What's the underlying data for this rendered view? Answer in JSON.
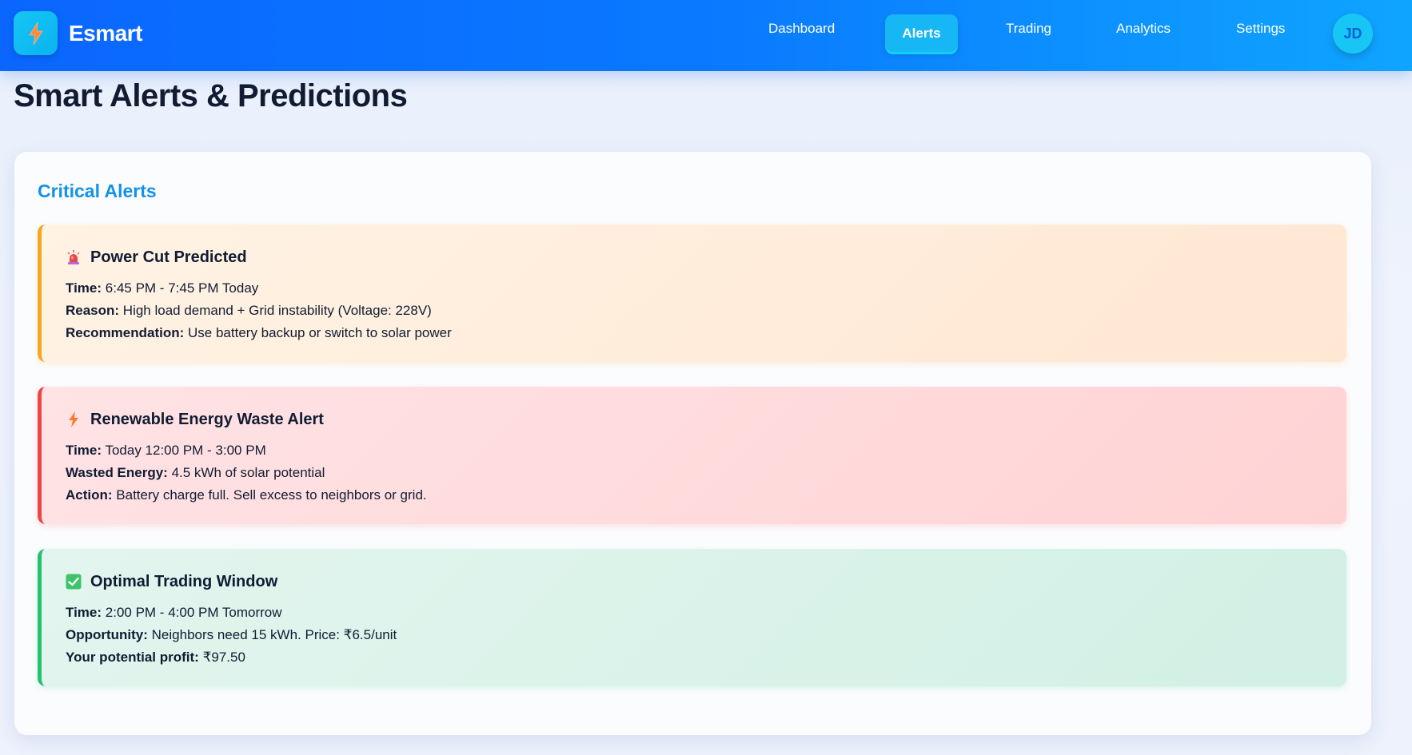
{
  "header": {
    "brand": "Esmart",
    "nav": {
      "dashboard": "Dashboard",
      "alerts": "Alerts",
      "trading": "Trading",
      "analytics": "Analytics",
      "settings": "Settings"
    },
    "avatar_initials": "JD",
    "active_tab": "Alerts"
  },
  "page": {
    "title": "Smart Alerts & Predictions"
  },
  "section": {
    "title": "Critical Alerts"
  },
  "alerts": [
    {
      "icon": "siren-icon",
      "title": "Power Cut Predicted",
      "color": "#f5a623",
      "lines": [
        {
          "label": "Time:",
          "value": " 6:45 PM - 7:45 PM Today"
        },
        {
          "label": "Reason:",
          "value": " High load demand + Grid instability (Voltage: 228V)"
        },
        {
          "label": "Recommendation:",
          "value": " Use battery backup or switch to solar power"
        }
      ]
    },
    {
      "icon": "lightning-icon",
      "title": "Renewable Energy Waste Alert",
      "color": "#f04545",
      "lines": [
        {
          "label": "Time:",
          "value": " Today 12:00 PM - 3:00 PM"
        },
        {
          "label": "Wasted Energy:",
          "value": " 4.5 kWh of solar potential"
        },
        {
          "label": "Action:",
          "value": " Battery charge full. Sell excess to neighbors or grid."
        }
      ]
    },
    {
      "icon": "check-box-icon",
      "title": "Optimal Trading Window",
      "color": "#22c36b",
      "lines": [
        {
          "label": "Time:",
          "value": " 2:00 PM - 4:00 PM Tomorrow"
        },
        {
          "label": "Opportunity:",
          "value": " Neighbors need 15 kWh. Price: ₹6.5/unit"
        },
        {
          "label": "Your potential profit:",
          "value": " ₹97.50"
        }
      ]
    }
  ]
}
